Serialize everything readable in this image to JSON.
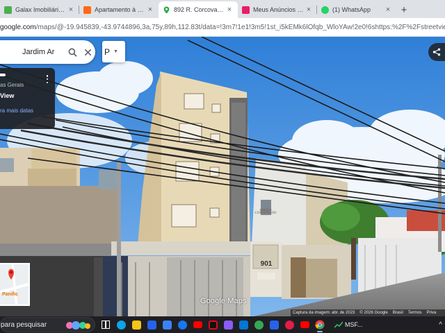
{
  "browser": {
    "tabs": [
      {
        "title": "Galax Imobiliária - A",
        "favicon": "house-icon",
        "color": "#4caf50",
        "active": false
      },
      {
        "title": "Apartamento à venda",
        "favicon": "home-orange-icon",
        "color": "#ff6a13",
        "active": false
      },
      {
        "title": "892 R. Corcovado - G",
        "favicon": "maps-pin-icon",
        "color": "#34a853",
        "active": true
      },
      {
        "title": "Meus Anúncios | Ch",
        "favicon": "listing-icon",
        "color": "#e91e63",
        "active": false
      },
      {
        "title": "(1) WhatsApp",
        "favicon": "whatsapp-icon",
        "color": "#25d366",
        "active": false
      }
    ],
    "close_glyph": "×",
    "new_tab_glyph": "+",
    "url_host": "google.com",
    "url_rest": "/maps/@-19.945839,-43.9744896,3a,75y,89h,112.83t/data=!3m7!1e1!3m5!1st_i5kEMk6lOfqb_WloYAw!2e0!6shttps:%2F%2Fstreetviewpixels-pa.google..."
  },
  "maps": {
    "search_query": "Jardim Ar",
    "layer_label": "P",
    "info_card": {
      "region": "as Gerais",
      "view_label": "View",
      "more_dates": "ra mais datas"
    },
    "minimap_label": "Panific",
    "watermark": "Google Maps",
    "attribution": {
      "capture": "Captura da imagem: abr. de 2023",
      "copyright": "© 2026 Google",
      "country": "Brasil",
      "terms": "Termos",
      "privacy": "Priva"
    },
    "building_sign": {
      "line1": "EDIFÍCIO",
      "line2": "CORCOVADO",
      "number": "901"
    }
  },
  "taskbar": {
    "search_placeholder": "para pesquisar",
    "apps": [
      {
        "name": "task-view-icon",
        "color": "#ffffff"
      },
      {
        "name": "edge-icon",
        "color": "#0ea5e9"
      },
      {
        "name": "file-explorer-icon",
        "color": "#f5c518"
      },
      {
        "name": "store-icon",
        "color": "#2563eb"
      },
      {
        "name": "mail-icon",
        "color": "#3b82f6"
      },
      {
        "name": "facebook-icon",
        "color": "#1877f2"
      },
      {
        "name": "youtube-icon",
        "color": "#ff0000"
      },
      {
        "name": "netflix-icon",
        "color": "#e50914"
      },
      {
        "name": "media-icon",
        "color": "#8b5cf6"
      },
      {
        "name": "outlook-icon",
        "color": "#0078d4"
      },
      {
        "name": "maps-icon",
        "color": "#34a853"
      },
      {
        "name": "news-icon",
        "color": "#2563eb"
      },
      {
        "name": "opera-icon",
        "color": "#e11d48"
      },
      {
        "name": "youtube-alt-icon",
        "color": "#ff0000"
      },
      {
        "name": "chrome-icon",
        "color": "#fbbc04"
      }
    ],
    "stock_label": "MSF..."
  },
  "colors": {
    "sky": "#3d8fe0",
    "building": "#e8d9b6",
    "accent_blue": "#1a73e8"
  }
}
